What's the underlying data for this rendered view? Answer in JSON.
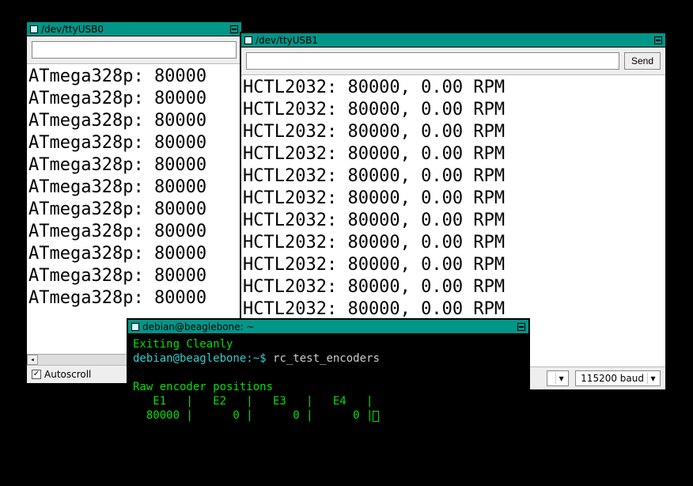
{
  "windows": {
    "usb0": {
      "title": "/dev/ttyUSB0",
      "lines": [
        "ATmega328p: 80000",
        "ATmega328p: 80000",
        "ATmega328p: 80000",
        "ATmega328p: 80000",
        "ATmega328p: 80000",
        "ATmega328p: 80000",
        "ATmega328p: 80000",
        "ATmega328p: 80000",
        "ATmega328p: 80000",
        "ATmega328p: 80000",
        "ATmega328p: 80000"
      ],
      "autoscroll_label": "Autoscroll",
      "autoscroll_checked": true
    },
    "usb1": {
      "title": "/dev/ttyUSB1",
      "send_label": "Send",
      "lines": [
        "HCTL2032: 80000, 0.00 RPM",
        "HCTL2032: 80000, 0.00 RPM",
        "HCTL2032: 80000, 0.00 RPM",
        "HCTL2032: 80000, 0.00 RPM",
        "HCTL2032: 80000, 0.00 RPM",
        "HCTL2032: 80000, 0.00 RPM",
        "HCTL2032: 80000, 0.00 RPM",
        "HCTL2032: 80000, 0.00 RPM",
        "HCTL2032: 80000, 0.00 RPM",
        "HCTL2032: 80000, 0.00 RPM",
        "HCTL2032: 80000, 0.00 RPM"
      ],
      "baud_label": "115200 baud",
      "line_ending_label": ""
    },
    "terminal": {
      "title": "debian@beaglebone: ~",
      "exit_line": "Exiting Cleanly",
      "prompt": "debian@beaglebone:~$ ",
      "command": "rc_test_encoders",
      "header": "Raw encoder positions",
      "cols": "   E1   |   E2   |   E3   |   E4   |",
      "vals": "  80000 |      0 |      0 |      0 |"
    }
  }
}
